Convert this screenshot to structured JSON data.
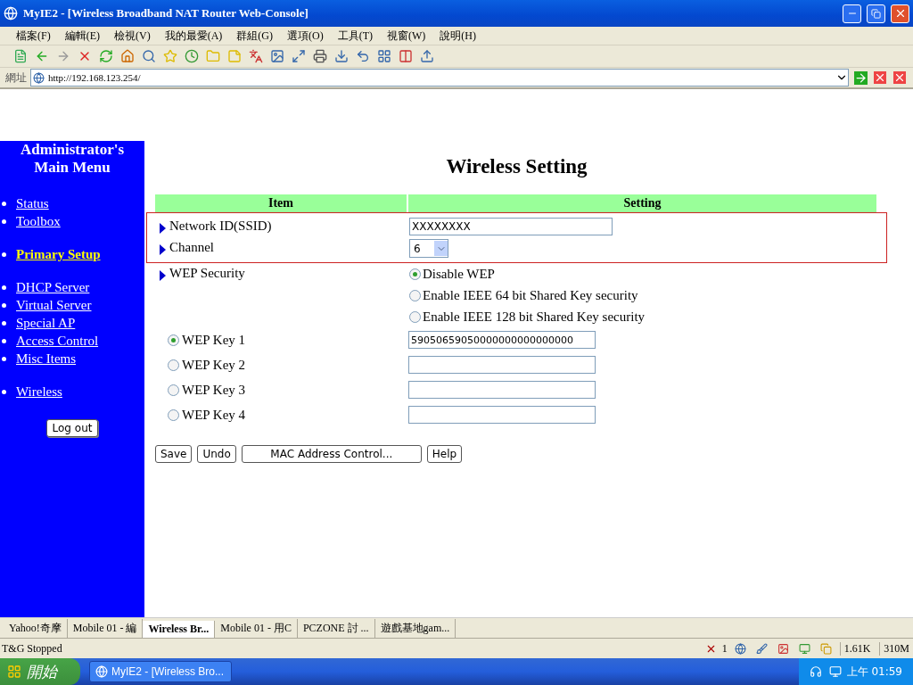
{
  "window": {
    "title": "MyIE2 - [Wireless Broadband NAT Router Web-Console]"
  },
  "menu": [
    "檔案(F)",
    "編輯(E)",
    "檢視(V)",
    "我的最愛(A)",
    "群組(G)",
    "選項(O)",
    "工具(T)",
    "視窗(W)",
    "說明(H)"
  ],
  "address": {
    "label": "網址",
    "url": "http://192.168.123.254/"
  },
  "sidebar": {
    "title": [
      "Administrator's",
      "Main Menu"
    ],
    "groups": [
      [
        {
          "label": "Status",
          "selected": false
        },
        {
          "label": "Toolbox",
          "selected": false
        }
      ],
      [
        {
          "label": "Primary Setup",
          "selected": true
        }
      ],
      [
        {
          "label": "DHCP Server",
          "selected": false
        },
        {
          "label": "Virtual Server",
          "selected": false
        },
        {
          "label": "Special AP",
          "selected": false
        },
        {
          "label": "Access Control",
          "selected": false
        },
        {
          "label": "Misc Items",
          "selected": false
        }
      ],
      [
        {
          "label": "Wireless",
          "selected": false
        }
      ]
    ],
    "logout": "Log out"
  },
  "page": {
    "title": "Wireless Setting",
    "columns": [
      "Item",
      "Setting"
    ],
    "rows": [
      {
        "kind": "text",
        "label": "Network ID(SSID)",
        "value": "XXXXXXXX",
        "highlighted": true
      },
      {
        "kind": "select",
        "label": "Channel",
        "value": "6",
        "highlighted": true
      },
      {
        "kind": "radios",
        "label": "WEP Security",
        "highlighted": false,
        "options": [
          {
            "label": "Disable WEP",
            "selected": true
          },
          {
            "label": "Enable IEEE 64 bit Shared Key security",
            "selected": false
          },
          {
            "label": "Enable IEEE 128 bit Shared Key security",
            "selected": false
          }
        ]
      }
    ],
    "wep_keys": [
      {
        "label": "WEP Key 1",
        "selected": true,
        "value": "59050659050000000000000000"
      },
      {
        "label": "WEP Key 2",
        "selected": false
      },
      {
        "label": "WEP Key 3",
        "selected": false
      },
      {
        "label": "WEP Key 4",
        "selected": false
      }
    ],
    "buttons": [
      "Save",
      "Undo",
      "MAC Address Control...",
      "Help"
    ]
  },
  "tabs": [
    {
      "label": "Yahoo!奇摩",
      "selected": false
    },
    {
      "label": "Mobile 01 - 編",
      "selected": false
    },
    {
      "label": "Wireless Br...",
      "selected": true
    },
    {
      "label": "Mobile 01 - 用C",
      "selected": false
    },
    {
      "label": "PCZONE 討 ...",
      "selected": false
    },
    {
      "label": "遊戲基地gam...",
      "selected": false
    }
  ],
  "status": {
    "text": "T&G Stopped",
    "blocked": "1",
    "traffic": "1.61K",
    "memory": "310M"
  },
  "taskbar": {
    "start": "開始",
    "task": "MyIE2 - [Wireless Bro...",
    "clock": "上午 01:59"
  }
}
